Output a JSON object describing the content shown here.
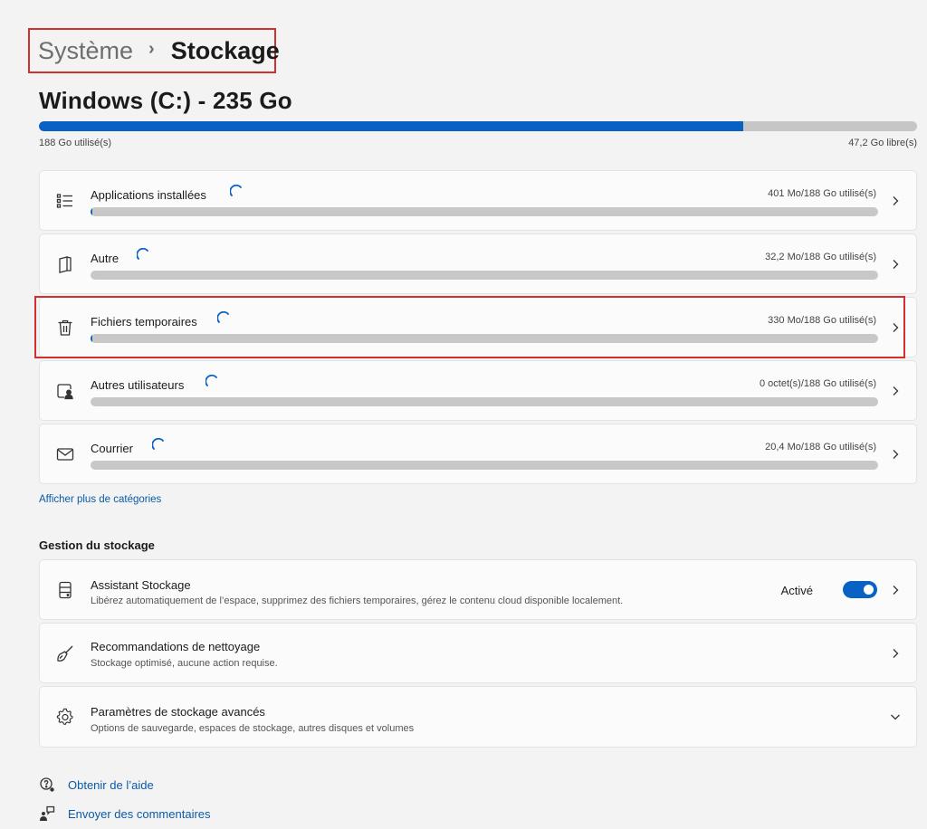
{
  "breadcrumb": {
    "parent": "Système",
    "separator": "›",
    "current": "Stockage"
  },
  "drive": {
    "title": "Windows (C:) - 235 Go",
    "used_label": "188 Go utilisé(s)",
    "free_label": "47,2 Go libre(s)",
    "used_percent": 80
  },
  "categories": [
    {
      "name": "Applications installées",
      "size": "401 Mo/188 Go utilisé(s)",
      "icon": "list-icon",
      "fill_percent": 0.2
    },
    {
      "name": "Autre",
      "size": "32,2 Mo/188 Go utilisé(s)",
      "icon": "document-icon",
      "fill_percent": 0.02
    },
    {
      "name": "Fichiers temporaires",
      "size": "330 Mo/188 Go utilisé(s)",
      "icon": "trash-icon",
      "fill_percent": 0.18
    },
    {
      "name": "Autres utilisateurs",
      "size": "0 octet(s)/188 Go utilisé(s)",
      "icon": "user-icon",
      "fill_percent": 0
    },
    {
      "name": "Courrier",
      "size": "20,4 Mo/188 Go utilisé(s)",
      "icon": "mail-icon",
      "fill_percent": 0.01
    }
  ],
  "more_categories_link": "Afficher plus de catégories",
  "management": {
    "section_title": "Gestion du stockage",
    "items": [
      {
        "title": "Assistant Stockage",
        "desc": "Libérez automatiquement de l’espace, supprimez des fichiers temporaires, gérez le contenu cloud disponible localement.",
        "toggle_label": "Activé",
        "toggle_on": true,
        "icon": "drive-icon"
      },
      {
        "title": "Recommandations de nettoyage",
        "desc": "Stockage optimisé, aucune action requise.",
        "icon": "broom-icon"
      },
      {
        "title": "Paramètres de stockage avancés",
        "desc": "Options de sauvegarde, espaces de stockage, autres disques et volumes",
        "icon": "gear-icon"
      }
    ]
  },
  "footer": {
    "help": "Obtenir de l’aide",
    "feedback": "Envoyer des commentaires"
  },
  "colors": {
    "accent": "#0862c4",
    "highlight": "#d32f2f",
    "link": "#0a5aa8"
  }
}
